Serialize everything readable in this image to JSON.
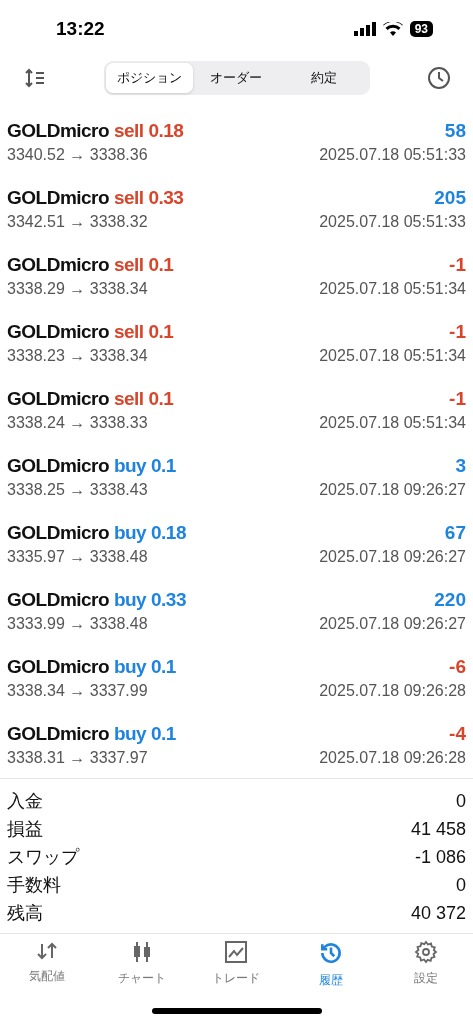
{
  "status_bar": {
    "time": "13:22",
    "battery": "93"
  },
  "toolbar": {
    "segments": [
      {
        "label": "ポジション",
        "selected": true
      },
      {
        "label": "オーダー",
        "selected": false
      },
      {
        "label": "約定",
        "selected": false
      }
    ]
  },
  "trades": [
    {
      "symbol": "GOLDmicro",
      "side": "sell",
      "volume": "0.18",
      "prices": "3340.52 → 3338.36",
      "profit": "58",
      "color": "#1f84e0",
      "time": "2025.07.18 05:51:33"
    },
    {
      "symbol": "GOLDmicro",
      "side": "sell",
      "volume": "0.33",
      "prices": "3342.51 → 3338.32",
      "profit": "205",
      "color": "#1f84e0",
      "time": "2025.07.18 05:51:33"
    },
    {
      "symbol": "GOLDmicro",
      "side": "sell",
      "volume": "0.1",
      "prices": "3338.29 → 3338.34",
      "profit": "-1",
      "color": "#d9452b",
      "time": "2025.07.18 05:51:34"
    },
    {
      "symbol": "GOLDmicro",
      "side": "sell",
      "volume": "0.1",
      "prices": "3338.23 → 3338.34",
      "profit": "-1",
      "color": "#d9452b",
      "time": "2025.07.18 05:51:34"
    },
    {
      "symbol": "GOLDmicro",
      "side": "sell",
      "volume": "0.1",
      "prices": "3338.24 → 3338.33",
      "profit": "-1",
      "color": "#d9452b",
      "time": "2025.07.18 05:51:34"
    },
    {
      "symbol": "GOLDmicro",
      "side": "buy",
      "volume": "0.1",
      "prices": "3338.25 → 3338.43",
      "profit": "3",
      "color": "#1f84e0",
      "time": "2025.07.18 09:26:27"
    },
    {
      "symbol": "GOLDmicro",
      "side": "buy",
      "volume": "0.18",
      "prices": "3335.97 → 3338.48",
      "profit": "67",
      "color": "#1f84e0",
      "time": "2025.07.18 09:26:27"
    },
    {
      "symbol": "GOLDmicro",
      "side": "buy",
      "volume": "0.33",
      "prices": "3333.99 → 3338.48",
      "profit": "220",
      "color": "#1f84e0",
      "time": "2025.07.18 09:26:27"
    },
    {
      "symbol": "GOLDmicro",
      "side": "buy",
      "volume": "0.1",
      "prices": "3338.34 → 3337.99",
      "profit": "-6",
      "color": "#d9452b",
      "time": "2025.07.18 09:26:28"
    },
    {
      "symbol": "GOLDmicro",
      "side": "buy",
      "volume": "0.1",
      "prices": "3338.31 → 3337.97",
      "profit": "-4",
      "color": "#d9452b",
      "time": "2025.07.18 09:26:28"
    }
  ],
  "summary": [
    {
      "label": "入金",
      "value": "0"
    },
    {
      "label": "損益",
      "value": "41 458"
    },
    {
      "label": "スワップ",
      "value": "-1 086"
    },
    {
      "label": "手数料",
      "value": "0"
    },
    {
      "label": "残高",
      "value": "40 372"
    }
  ],
  "tab_bar": [
    {
      "kind": "quotes",
      "label": "気配値",
      "selected": false
    },
    {
      "kind": "chart",
      "label": "チャート",
      "selected": false
    },
    {
      "kind": "trade",
      "label": "トレード",
      "selected": false
    },
    {
      "kind": "history",
      "label": "履歴",
      "selected": true
    },
    {
      "kind": "settings",
      "label": "設定",
      "selected": false
    }
  ]
}
